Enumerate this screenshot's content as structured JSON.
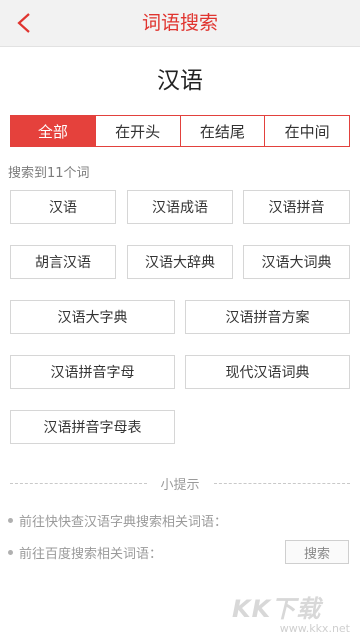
{
  "header": {
    "title": "词语搜索",
    "back_icon": "back-chevron-icon"
  },
  "query": "汉语",
  "tabs": [
    {
      "label": "全部",
      "active": true
    },
    {
      "label": "在开头",
      "active": false
    },
    {
      "label": "在结尾",
      "active": false
    },
    {
      "label": "在中间",
      "active": false
    }
  ],
  "result_count_text": "搜索到11个词",
  "results": [
    "汉语",
    "汉语成语",
    "汉语拼音",
    "胡言汉语",
    "汉语大辞典",
    "汉语大词典",
    "汉语大字典",
    "汉语拼音方案",
    "汉语拼音字母",
    "现代汉语词典",
    "汉语拼音字母表"
  ],
  "hints": {
    "title": "小提示",
    "items": [
      "前往快快查汉语字典搜索相关词语：",
      "前往百度搜索相关词语："
    ],
    "search_button": "搜索"
  },
  "watermark": {
    "logo": "KK下载",
    "url": "www.kkx.net"
  },
  "colors": {
    "accent": "#e5413c",
    "topbar_bg": "#f2f2f2"
  }
}
